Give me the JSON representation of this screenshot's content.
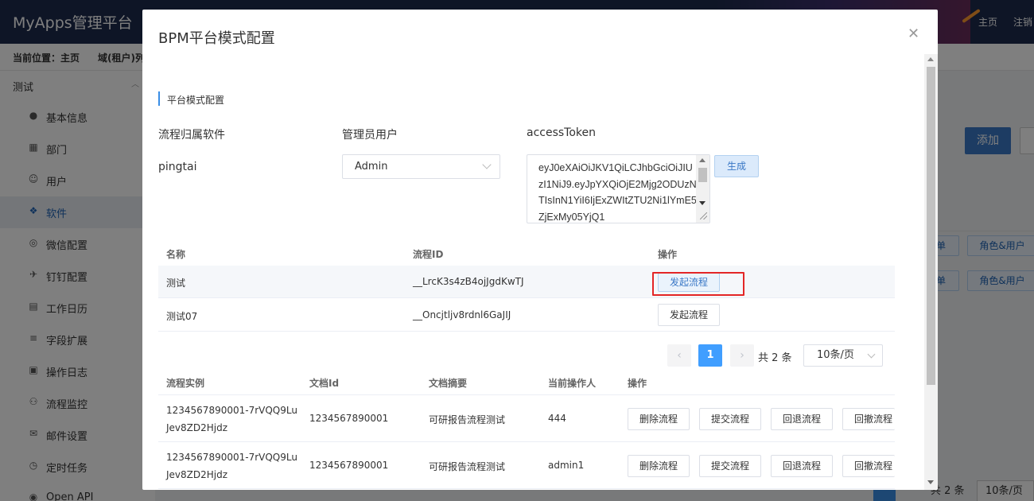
{
  "app": {
    "title": "MyApps管理平台",
    "top_links": [
      "主页",
      "注销"
    ]
  },
  "breadcrumb": {
    "current_label": "当前位置：主页",
    "next": "域(租户)列"
  },
  "sidebar": {
    "section": "测试",
    "items": [
      {
        "label": "基本信息",
        "icon": "info-icon"
      },
      {
        "label": "部门",
        "icon": "building-icon"
      },
      {
        "label": "用户",
        "icon": "user-icon"
      },
      {
        "label": "软件",
        "icon": "cubes-icon",
        "active": true
      },
      {
        "label": "微信配置",
        "icon": "wechat-icon"
      },
      {
        "label": "钉钉配置",
        "icon": "plane-icon"
      },
      {
        "label": "工作日历",
        "icon": "calendar-icon"
      },
      {
        "label": "字段扩展",
        "icon": "sliders-icon"
      },
      {
        "label": "操作日志",
        "icon": "log-icon"
      },
      {
        "label": "流程监控",
        "icon": "monitor-icon"
      },
      {
        "label": "邮件设置",
        "icon": "mail-icon"
      },
      {
        "label": "定时任务",
        "icon": "clock-icon"
      },
      {
        "label": "Open API",
        "icon": "api-icon"
      }
    ]
  },
  "background": {
    "add_label": "添加",
    "tag_a": "单",
    "tag_b": "角色&用户",
    "pager_total": "共 2 条",
    "page_size": "10条/页"
  },
  "modal": {
    "title": "BPM平台模式配置",
    "section_title": "平台模式配置",
    "fields": {
      "software_label": "流程归属软件",
      "software_value": "pingtai",
      "admin_label": "管理员用户",
      "admin_value": "Admin",
      "token_label": "accessToken",
      "token_value": "eyJ0eXAiOiJKV1QiLCJhbGciOiJIUzI1NiJ9.eyJpYXQiOjE2Mjg2ODUzNTIsInN1YiI6IjExZWItZTU2Ni1lYmE5ZjExMy05YjQ1",
      "generate_label": "生成"
    },
    "flow_table": {
      "headers": [
        "名称",
        "流程ID",
        "操作"
      ],
      "rows": [
        {
          "name": "测试",
          "id": "__LrcK3s4zB4ojJgdKwTJ",
          "action": "发起流程"
        },
        {
          "name": "测试07",
          "id": "__Oncjtljv8rdnl6GaJIJ",
          "action": "发起流程"
        }
      ]
    },
    "pager": {
      "prev": "‹",
      "current": "1",
      "next": "›",
      "total": "共 2 条",
      "page_size": "10条/页"
    },
    "instance_table": {
      "headers": [
        "流程实例",
        "文档Id",
        "文档摘要",
        "当前操作人",
        "操作"
      ],
      "rows": [
        {
          "instance": "1234567890001-7rVQQ9LuJev8ZD2Hjdz",
          "doc_id": "1234567890001",
          "summary": "可研报告流程测试",
          "operator": "444"
        },
        {
          "instance": "1234567890001-7rVQQ9LuJev8ZD2Hjdz",
          "doc_id": "1234567890001",
          "summary": "可研报告流程测试",
          "operator": "admin1"
        }
      ],
      "actions": [
        "删除流程",
        "提交流程",
        "回退流程",
        "回撤流程"
      ]
    }
  }
}
